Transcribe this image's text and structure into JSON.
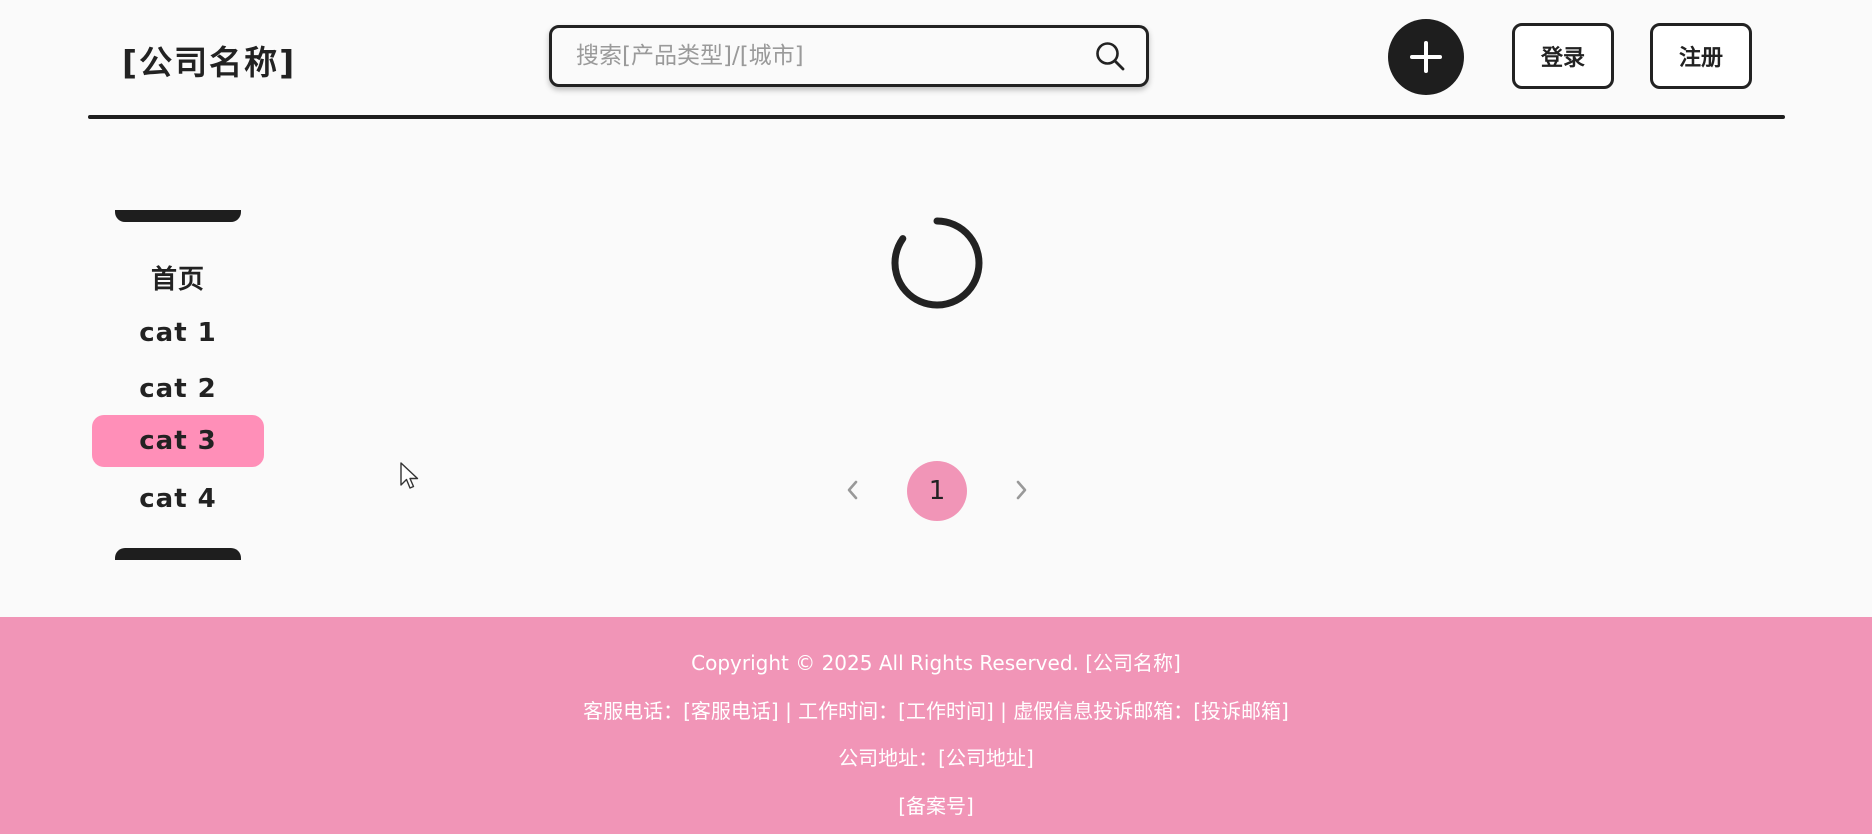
{
  "header": {
    "brand": "[公司名称]",
    "search": {
      "placeholder": "搜索[产品类型]/[城市]",
      "value": ""
    },
    "add_icon": "plus-icon",
    "login_label": "登录",
    "register_label": "注册"
  },
  "sidebar": {
    "items": [
      {
        "label": "首页",
        "active": false
      },
      {
        "label": "cat 1",
        "active": false
      },
      {
        "label": "cat 2",
        "active": false
      },
      {
        "label": "cat 3",
        "active": true
      },
      {
        "label": "cat 4",
        "active": false
      }
    ]
  },
  "main": {
    "loading": true,
    "pagination": {
      "current_page": "1",
      "prev_icon": "chevron-left-icon",
      "next_icon": "chevron-right-icon"
    }
  },
  "footer": {
    "copyright": "Copyright © 2025 All Rights Reserved. [公司名称]",
    "contact": "客服电话：[客服电话] | 工作时间：[工作时间] | 虚假信息投诉邮箱：[投诉邮箱]",
    "address": "公司地址：[公司地址]",
    "record": "[备案号]"
  },
  "colors": {
    "accent_pink": "#f195b7",
    "active_pink": "#ff8fb8",
    "dark": "#1e1e1e",
    "background": "#fafafa"
  }
}
